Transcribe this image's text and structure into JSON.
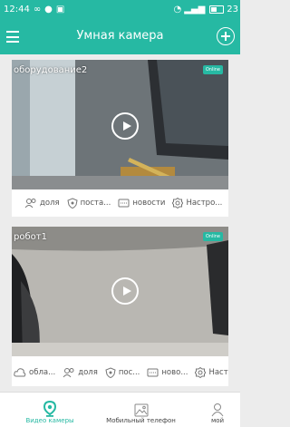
{
  "status": {
    "time": "12:44",
    "battery": "23"
  },
  "header": {
    "title": "Умная камера"
  },
  "cameras": [
    {
      "name": "оборудование2",
      "online": "Online",
      "actions": [
        "доля",
        "поста...",
        "новости",
        "Настро..."
      ]
    },
    {
      "name": "робот1",
      "online": "Online",
      "actions": [
        "обла...",
        "доля",
        "пос...",
        "ново...",
        "Наст..."
      ]
    }
  ],
  "nav": {
    "cams": "Видео камеры",
    "mobile": "Мобильный телефон",
    "mine": "мой"
  },
  "colors": {
    "accent": "#26b9a3"
  }
}
